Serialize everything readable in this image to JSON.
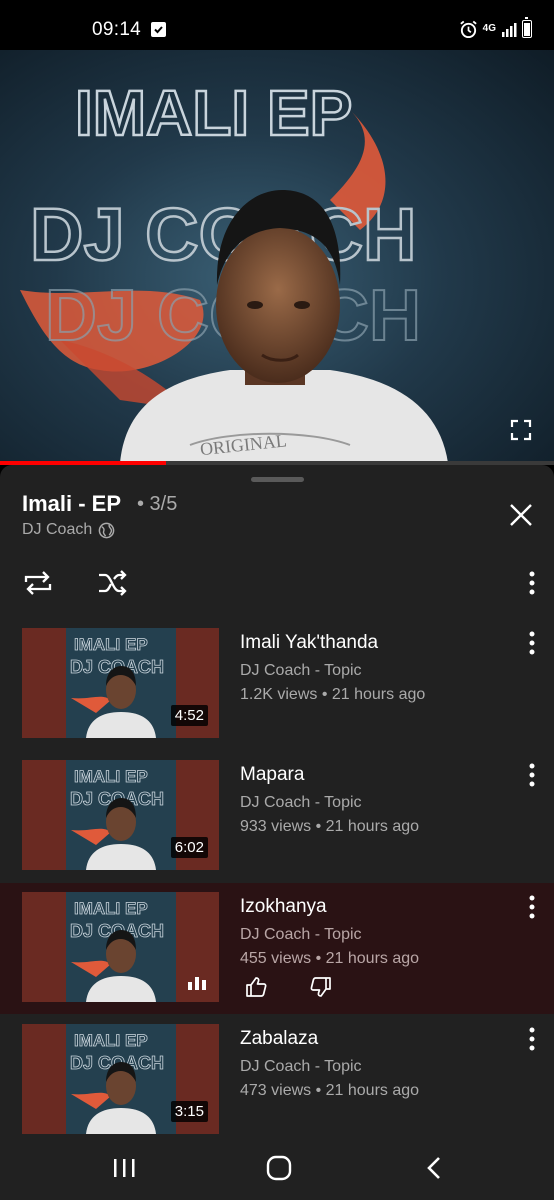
{
  "status_bar": {
    "time": "09:14",
    "network": "4G",
    "icons": [
      "check-notification-icon",
      "alarm-icon",
      "signal-icon",
      "battery-icon"
    ]
  },
  "video": {
    "cover_text": {
      "line1": "IMALI EP",
      "line2": "DJ COACH",
      "line3": "DJ COACH",
      "shirt": "ORIGINAL"
    },
    "progress": 0.3,
    "progress_color": "#ff0000"
  },
  "playlist": {
    "title": "Imali - EP",
    "position": "• 3/5",
    "channel": "DJ Coach",
    "items": [
      {
        "title": "Imali Yak'thanda",
        "channel": "DJ Coach - Topic",
        "meta": "1.2K views • 21 hours ago",
        "duration": "4:52"
      },
      {
        "title": "Mapara",
        "channel": "DJ Coach - Topic",
        "meta": "933 views • 21 hours ago",
        "duration": "6:02"
      },
      {
        "title": "Izokhanya",
        "channel": "DJ Coach - Topic",
        "meta": "455 views • 21 hours ago",
        "duration": ""
      },
      {
        "title": "Zabalaza",
        "channel": "DJ Coach - Topic",
        "meta": "473 views • 21 hours ago",
        "duration": "3:15"
      }
    ],
    "current_index": 2
  },
  "colors": {
    "panel_bg": "#212121",
    "current_row_bg": "#2a1214",
    "thumb_bg": "#6a2a22",
    "secondary_text": "#aaaaaa"
  }
}
